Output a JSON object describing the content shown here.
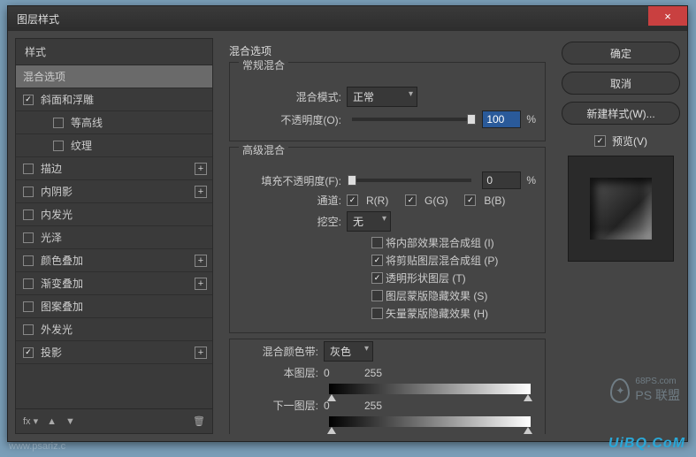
{
  "titlebar": {
    "title": "图层样式"
  },
  "close_icon": "×",
  "sidebar": {
    "header": "样式",
    "items": [
      {
        "label": "混合选项",
        "checked": null,
        "selected": true,
        "add": false
      },
      {
        "label": "斜面和浮雕",
        "checked": true,
        "add": false
      },
      {
        "label": "等高线",
        "checked": false,
        "sub": true,
        "add": false
      },
      {
        "label": "纹理",
        "checked": false,
        "sub": true,
        "add": false
      },
      {
        "label": "描边",
        "checked": false,
        "add": true
      },
      {
        "label": "内阴影",
        "checked": false,
        "add": true
      },
      {
        "label": "内发光",
        "checked": false,
        "add": false
      },
      {
        "label": "光泽",
        "checked": false,
        "add": false
      },
      {
        "label": "颜色叠加",
        "checked": false,
        "add": true
      },
      {
        "label": "渐变叠加",
        "checked": false,
        "add": true
      },
      {
        "label": "图案叠加",
        "checked": false,
        "add": false
      },
      {
        "label": "外发光",
        "checked": false,
        "add": false
      },
      {
        "label": "投影",
        "checked": true,
        "add": true
      }
    ],
    "footer": {
      "fx": "fx",
      "up": "▲",
      "down": "▼",
      "trash": "🗑"
    }
  },
  "main": {
    "panel_title": "混合选项",
    "normal_blend": {
      "title": "常规混合",
      "mode_label": "混合模式:",
      "mode_value": "正常",
      "opacity_label": "不透明度(O):",
      "opacity_value": "100",
      "pct": "%"
    },
    "advanced": {
      "title": "高级混合",
      "fill_label": "填充不透明度(F):",
      "fill_value": "0",
      "pct": "%",
      "channel_label": "通道:",
      "ch_r": "R(R)",
      "ch_g": "G(G)",
      "ch_b": "B(B)",
      "knockout_label": "挖空:",
      "knockout_value": "无",
      "opts": [
        {
          "label": "将内部效果混合成组 (I)",
          "on": false
        },
        {
          "label": "将剪贴图层混合成组 (P)",
          "on": true
        },
        {
          "label": "透明形状图层 (T)",
          "on": true
        },
        {
          "label": "图层蒙版隐藏效果 (S)",
          "on": false
        },
        {
          "label": "矢量蒙版隐藏效果 (H)",
          "on": false
        }
      ]
    },
    "blendif": {
      "title_label": "混合颜色带:",
      "value": "灰色",
      "this_label": "本图层:",
      "this_lo": "0",
      "this_hi": "255",
      "under_label": "下一图层:",
      "under_lo": "0",
      "under_hi": "255"
    }
  },
  "right": {
    "ok": "确定",
    "cancel": "取消",
    "newstyle": "新建样式(W)...",
    "preview_label": "预览(V)"
  },
  "watermark": {
    "text": "PS 联盟",
    "site": "68PS.com",
    "footer": "UiBQ.CoM",
    "ps": "www.psariz.c"
  }
}
